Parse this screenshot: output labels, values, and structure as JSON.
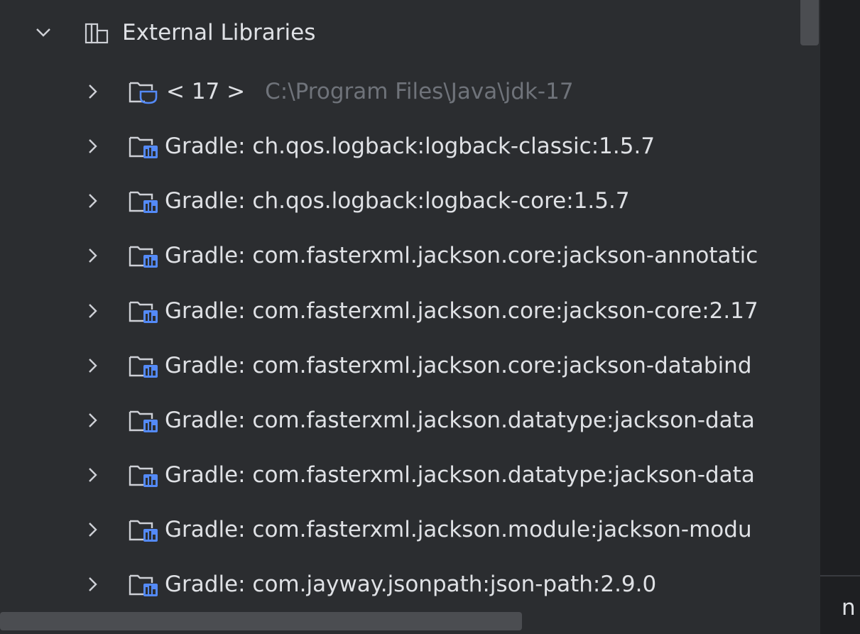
{
  "root": {
    "label": "External Libraries",
    "expanded": true,
    "icon": "library-icon"
  },
  "items": [
    {
      "label": "< 17 >",
      "path": "C:\\Program Files\\Java\\jdk-17",
      "icon": "jdk-folder-icon"
    },
    {
      "label": "Gradle: ch.qos.logback:logback-classic:1.5.7",
      "icon": "gradle-library-icon"
    },
    {
      "label": "Gradle: ch.qos.logback:logback-core:1.5.7",
      "icon": "gradle-library-icon"
    },
    {
      "label": "Gradle: com.fasterxml.jackson.core:jackson-annotatic",
      "icon": "gradle-library-icon"
    },
    {
      "label": "Gradle: com.fasterxml.jackson.core:jackson-core:2.17",
      "icon": "gradle-library-icon"
    },
    {
      "label": "Gradle: com.fasterxml.jackson.core:jackson-databind",
      "icon": "gradle-library-icon"
    },
    {
      "label": "Gradle: com.fasterxml.jackson.datatype:jackson-data",
      "icon": "gradle-library-icon"
    },
    {
      "label": "Gradle: com.fasterxml.jackson.datatype:jackson-data",
      "icon": "gradle-library-icon"
    },
    {
      "label": "Gradle: com.fasterxml.jackson.module:jackson-modu",
      "icon": "gradle-library-icon"
    },
    {
      "label": "Gradle: com.jayway.jsonpath:json-path:2.9.0",
      "icon": "gradle-library-icon"
    }
  ],
  "right_panel": {
    "partial_text": "n"
  },
  "colors": {
    "background": "#2b2d30",
    "text": "#dfe1e5",
    "path_text": "#6f737a",
    "accent_blue": "#548af7",
    "scrollbar": "#4b4d51",
    "editor_background": "#1e1f22"
  }
}
